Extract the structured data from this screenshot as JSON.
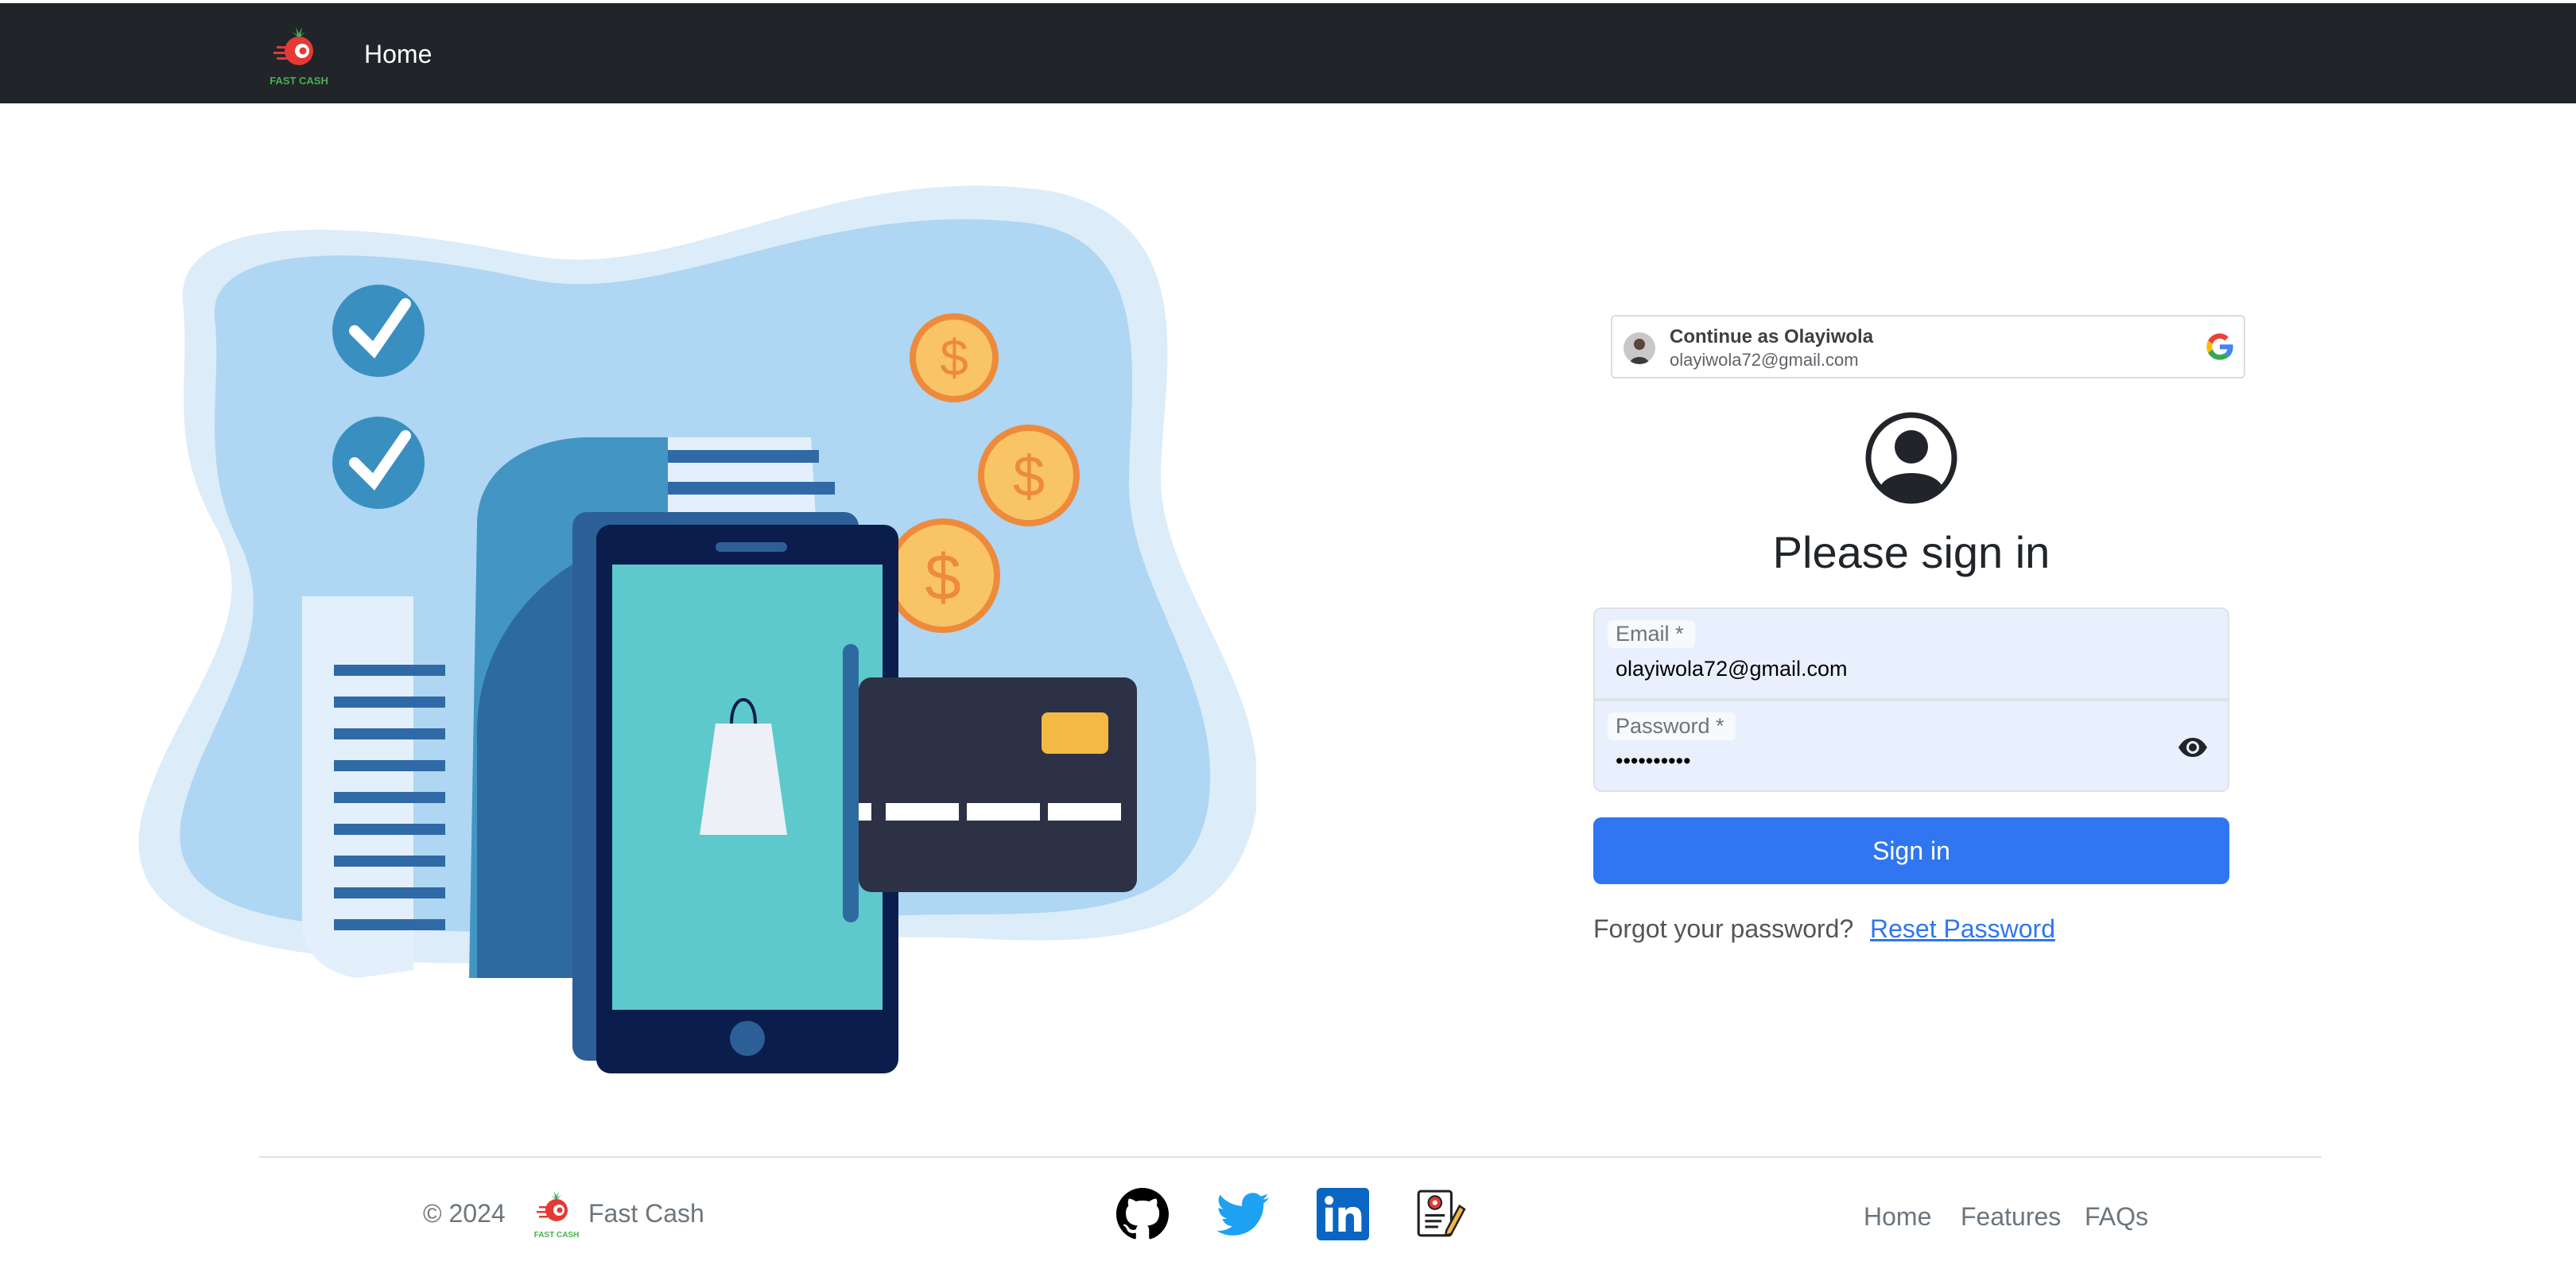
{
  "navbar": {
    "brand_logo_text": "FAST CASH",
    "home_label": "Home"
  },
  "google_one_tap": {
    "title": "Continue as Olayiwola",
    "email": "olayiwola72@gmail.com",
    "icon": "google-g-icon"
  },
  "signin": {
    "title": "Please sign in",
    "email_label": "Email *",
    "email_value": "olayiwola72@gmail.com",
    "password_label": "Password *",
    "password_value": "••••••••••",
    "password_toggle_icon": "eye-icon",
    "submit_label": "Sign in",
    "forgot_text": "Forgot your password?",
    "reset_link_label": "Reset Password"
  },
  "footer": {
    "copyright": "© 2024",
    "brand_logo_text": "FAST CASH",
    "brand_name": "Fast Cash",
    "social_icons": [
      "github-icon",
      "twitter-icon",
      "linkedin-icon",
      "certificate-icon"
    ],
    "links": {
      "home": "Home",
      "features": "Features",
      "faqs": "FAQs"
    }
  },
  "colors": {
    "navbar_bg": "#212529",
    "primary": "#2f76f0",
    "field_bg": "#e8f0fe",
    "brand_red": "#e53935",
    "brand_green": "#4caf50"
  }
}
